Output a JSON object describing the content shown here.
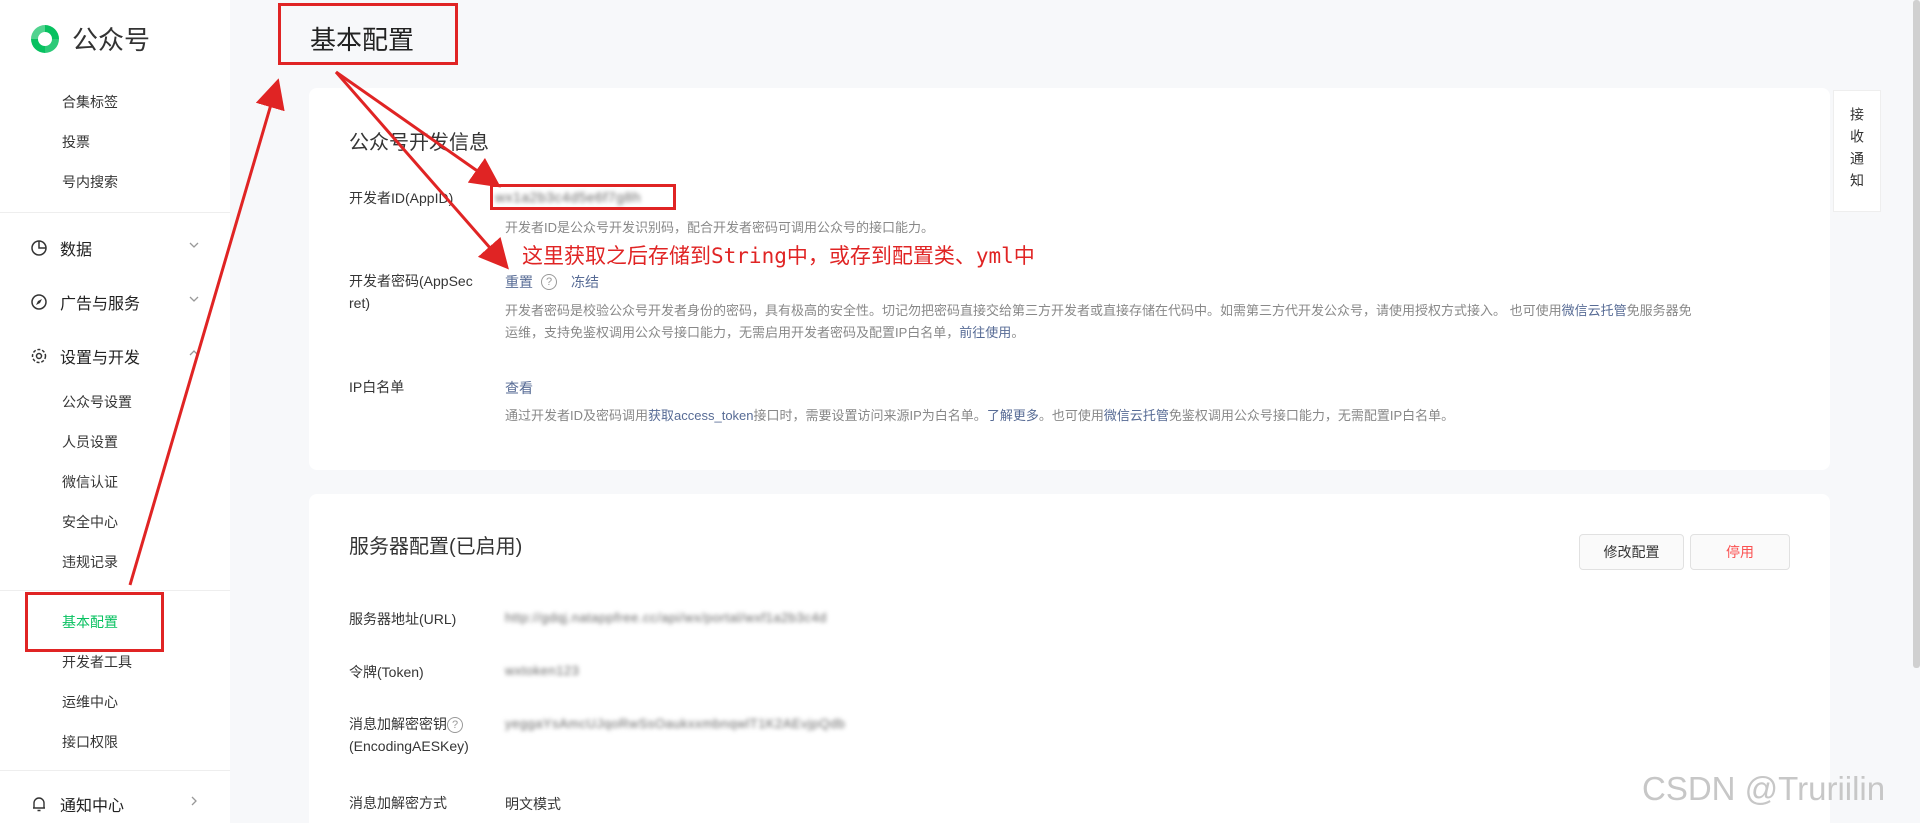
{
  "app": {
    "name": "公众号",
    "page_title": "基本配置"
  },
  "sidebar": {
    "top_items": [
      "合集标签",
      "投票",
      "号内搜索"
    ],
    "groups": {
      "data": "数据",
      "ads": "广告与服务",
      "settings": "设置与开发",
      "notice": "通知中心"
    },
    "settings_items": [
      "公众号设置",
      "人员设置",
      "微信认证",
      "安全中心",
      "违规记录",
      "基本配置",
      "开发者工具",
      "运维中心",
      "接口权限"
    ],
    "active_item": "基本配置"
  },
  "dev_info": {
    "title": "公众号开发信息",
    "appid_label": "开发者ID(AppID)",
    "appid_value": "wx1a2b3c4d5e6f7g8h",
    "appid_desc": "开发者ID是公众号开发识别码，配合开发者密码可调用公众号的接口能力。",
    "secret_label_1": "开发者密码(AppSec",
    "secret_label_2": "ret)",
    "secret_reset": "重置",
    "secret_freeze": "冻结",
    "secret_desc_1a": "开发者密码是校验公众号开发者身份的密码，具有极高的安全性。切记勿把密码直接交给第三方开发者或直接存储在代码中。如需第三方代开发公众号，请使用授权方式接入。 也可使用",
    "secret_desc_1b_link": "微信云托管",
    "secret_desc_1c": "免服务器免",
    "secret_desc_2a": "运维，支持免鉴权调用公众号接口能力，无需启用开发者密码及配置IP白名单，",
    "secret_desc_2b_link": "前往使用",
    "secret_desc_2c": "。",
    "ip_label": "IP白名单",
    "ip_view": "查看",
    "ip_desc_a": "通过开发者ID及密码调用",
    "ip_desc_b_link": "获取access_token",
    "ip_desc_c": "接口时，需要设置访问来源IP为白名单。",
    "ip_desc_d_link": "了解更多",
    "ip_desc_e": "。也可使用",
    "ip_desc_f_link": "微信云托管",
    "ip_desc_g": "免鉴权调用公众号接口能力，无需配置IP白名单。"
  },
  "server_config": {
    "title": "服务器配置(已启用)",
    "modify_btn": "修改配置",
    "disable_btn": "停用",
    "url_label": "服务器地址(URL)",
    "url_value": "http://gdqj.natappfree.cc/api/wx/portal/wxf1a2b3c4d",
    "token_label": "令牌(Token)",
    "token_value": "wxtoken123",
    "aes_label_1": "消息加解密密钥",
    "aes_label_2": "(EncodingAESKey)",
    "aes_value": "yeggaYsAmcUJqoRwSsOaukxxmbnqwlT1K2AEvjpQdb",
    "mode_label": "消息加解密方式",
    "mode_value": "明文模式"
  },
  "notify_tab": "接收通知",
  "annotation": "这里获取之后存储到String中，或存到配置类、yml中",
  "watermark": "CSDN @Truriilin",
  "colors": {
    "accent_green": "#07c160",
    "link": "#576b95",
    "annotation_red": "#e02424",
    "danger": "#fa5151"
  }
}
